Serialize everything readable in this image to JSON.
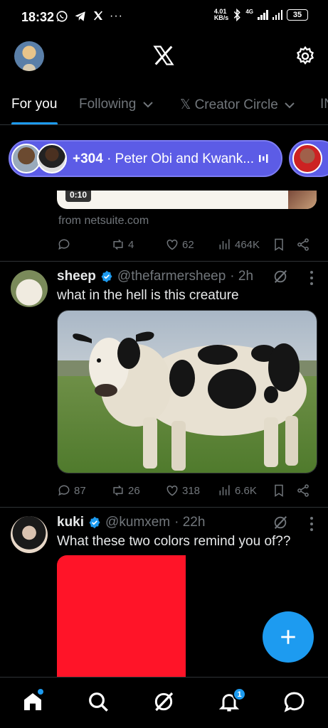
{
  "status_bar": {
    "time": "18:32",
    "net_speed": "4.01\nKB/s",
    "network": "4G",
    "battery": "35"
  },
  "header": {
    "logo_icon": "x-logo-icon",
    "settings_icon": "gear-icon"
  },
  "tabs": [
    {
      "label": "For you"
    },
    {
      "label": "Following"
    },
    {
      "label": "𝕏 Creator Circle"
    },
    {
      "label": "IN"
    }
  ],
  "spaces": {
    "count": "+304",
    "text": " · Peter Obi and Kwank..."
  },
  "prev_post": {
    "duration": "0:10",
    "source": "from netsuite.com",
    "replies": "",
    "reposts": "4",
    "likes": "62",
    "views": "464K"
  },
  "tweets": [
    {
      "name": "sheep",
      "handle": "@thefarmersheep",
      "time": "· 2h",
      "text": "what in the hell is this creature",
      "replies": "87",
      "reposts": "26",
      "likes": "318",
      "views": "6.6K"
    },
    {
      "name": "kuki",
      "handle": "@kumxem",
      "time": "· 22h",
      "text": "What these two colors remind you of??"
    }
  ],
  "colors": {
    "accent": "#1d9bf0",
    "spaces_pill": "#5c5ce6",
    "red_image": "#ff1428"
  },
  "bottom_nav": {
    "notif_count": "1",
    "icons": [
      "home-icon",
      "search-icon",
      "grok-icon",
      "notifications-icon",
      "messages-icon"
    ]
  }
}
